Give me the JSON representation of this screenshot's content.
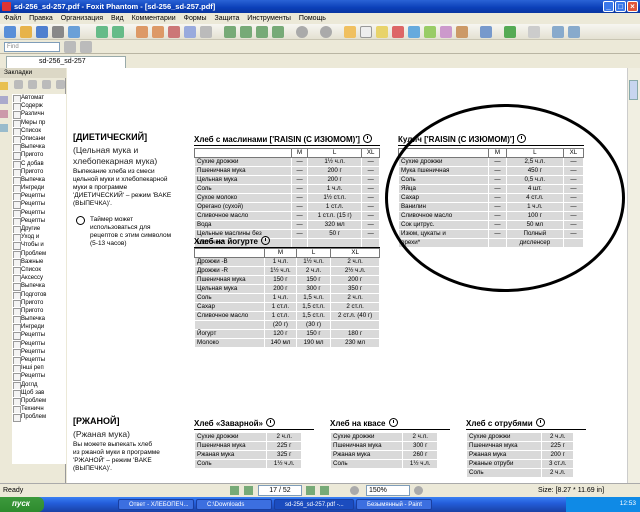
{
  "window": {
    "title": "sd-256_sd-257.pdf - Foxit Phantom - [sd-256_sd-257.pdf]"
  },
  "menu": [
    "Файл",
    "Правка",
    "Организация",
    "Вид",
    "Комментарии",
    "Формы",
    "Защита",
    "Инструменты",
    "Помощь"
  ],
  "find": {
    "placeholder": "Find"
  },
  "tab": {
    "label": "sd-256_sd-257"
  },
  "sidebar": {
    "title": "Закладки",
    "items": [
      "Автомат",
      "Содерж",
      "Различн",
      "Меры пр",
      "Список",
      "Описани",
      "Выпечка",
      "Пригото",
      "С добав",
      "Пригото",
      "Выпечка",
      "Ингреди",
      "Рецепты",
      "Рецепты",
      "Рецепты",
      "Рецепты",
      "Другие",
      "Уход и",
      "Чтобы и",
      "Проблем",
      "Важные",
      "Список",
      "Аксессу",
      "Выпечка",
      "Подготов",
      "Пригото",
      "Пригото",
      "Выпечка",
      "Ингреди",
      "Рецепты",
      "Рецепты",
      "Рецепты",
      "Рецепты",
      "Іншi реп",
      "Рецепты",
      "Доглд",
      "Щоб зав",
      "Проблем",
      "Техничн",
      "Проблем"
    ]
  },
  "doc": {
    "section1": {
      "heading": "[ДИЕТИЧЕСКИЙ]",
      "sub1": "(Цельная мука и",
      "sub2": "хлебопекарная мука)",
      "desc": [
        "Выпекание хлеба из смеси",
        "цельной муки и хлебопекарной",
        "муки в программе",
        "'ДИЕТИЧЕСКИЙ' – режим 'BAKE",
        "(ВЫПЕЧКА)'."
      ],
      "note": [
        "Таймер может",
        "использоваться для",
        "рецептов с этим символом",
        "(5-13 часов)"
      ]
    },
    "table_olive": {
      "title": "Хлеб с маслинами ['RAISIN (С ИЗЮМОМ)']",
      "cols": [
        "",
        "M",
        "L",
        "XL"
      ],
      "rows": [
        [
          "Сухие дрожжи",
          "—",
          "1½ ч.л.",
          "—"
        ],
        [
          "Пшеничная мука",
          "—",
          "200 г",
          "—"
        ],
        [
          "Цельная мука",
          "—",
          "200 г",
          "—"
        ],
        [
          "Соль",
          "—",
          "1 ч.л.",
          "—"
        ],
        [
          "Сухое молоко",
          "—",
          "1½ ст.л.",
          "—"
        ],
        [
          "Орегано (сухой)",
          "—",
          "1 ст.л.",
          "—"
        ],
        [
          "Сливочное масло",
          "—",
          "1 ст.л. (15 г)",
          "—"
        ],
        [
          "Вода",
          "—",
          "320 мл",
          "—"
        ],
        [
          "Цельные маслины без",
          "—",
          "50 г",
          "—"
        ],
        [
          "косточек*",
          "",
          "",
          ""
        ]
      ]
    },
    "table_yogurt": {
      "title": "Хлеб на йогурте",
      "cols": [
        "",
        "M",
        "L",
        "XL"
      ],
      "rows": [
        [
          "Дрожжи -B",
          "1 ч.л.",
          "1½ ч.л.",
          "2 ч.л."
        ],
        [
          "Дрожжи -R",
          "1½ ч.л.",
          "2 ч.л.",
          "2½ ч.л."
        ],
        [
          "Пшеничная мука",
          "150 г",
          "150 г",
          "200 г"
        ],
        [
          "Цельная мука",
          "200 г",
          "300 г",
          "350 г"
        ],
        [
          "Соль",
          "1 ч.л.",
          "1,5 ч.л.",
          "2 ч.л."
        ],
        [
          "Сахар",
          "1 ст.л.",
          "1,5 ст.л.",
          "2 ст.л."
        ],
        [
          "Сливочное масло",
          "1 ст.л.",
          "1,5 ст.л.",
          "2 ст.л. (40 г)"
        ],
        [
          "",
          "(20 г)",
          "(30 г)",
          ""
        ],
        [
          "Йогурт",
          "120 г",
          "150 г",
          "180 г"
        ],
        [
          "Молоко",
          "140 мл",
          "190 мл",
          "230 мл"
        ]
      ]
    },
    "table_kulich": {
      "title": "Кулич ['RAISIN (С ИЗЮМОМ)']",
      "cols": [
        "",
        "M",
        "L",
        "XL"
      ],
      "rows": [
        [
          "Сухие дрожжи",
          "—",
          "2,5 ч.л.",
          "—"
        ],
        [
          "Мука пшеничная",
          "—",
          "450 г",
          "—"
        ],
        [
          "Соль",
          "—",
          "0,5 ч.л.",
          "—"
        ],
        [
          "Яйца",
          "—",
          "4 шт.",
          "—"
        ],
        [
          "Сахар",
          "—",
          "4 ст.л.",
          "—"
        ],
        [
          "Ванилин",
          "—",
          "1 ч.л.",
          "—"
        ],
        [
          "Сливочное масло",
          "—",
          "100 г",
          "—"
        ],
        [
          "Сок цитрус.",
          "—",
          "50 мл",
          "—"
        ],
        [
          "Изюм, цукаты и",
          "—",
          "Полный",
          "—"
        ],
        [
          "орехи*",
          "",
          "дисленсер",
          ""
        ]
      ]
    },
    "section2": {
      "heading": "[РЖАНОЙ]",
      "sub1": "(Ржаная мука)",
      "desc": [
        "Вы можете выпекать хлеб",
        "из ржаной муки в программе",
        "'РЖАНОЙ' – режим 'BAKE",
        "(ВЫПЕЧКА)'."
      ]
    },
    "table_zavarnoy": {
      "title": "Хлеб «Заварной»",
      "rows": [
        [
          "Сухие дрожжи",
          "2 ч.л."
        ],
        [
          "Пшеничная мука",
          "225 г"
        ],
        [
          "Ржаная мука",
          "325 г"
        ],
        [
          "Соль",
          "1½ ч.л."
        ]
      ]
    },
    "table_kvas": {
      "title": "Хлеб на квасе",
      "rows": [
        [
          "Сухие дрожжи",
          "2 ч.л."
        ],
        [
          "Пшеничная мука",
          "300 г"
        ],
        [
          "Ржаная мука",
          "260 г"
        ],
        [
          "Соль",
          "1½ ч.л."
        ]
      ]
    },
    "table_otrubi": {
      "title": "Хлеб с отрубями",
      "rows": [
        [
          "Сухие дрожжи",
          "2 ч.л."
        ],
        [
          "Пшеничная мука",
          "225 г"
        ],
        [
          "Ржаная мука",
          "200 г"
        ],
        [
          "Ржаные отруби",
          "3 ст.л."
        ],
        [
          "Соль",
          "2 ч.л."
        ]
      ]
    }
  },
  "status": {
    "left": "Ready",
    "page": "17 / 52",
    "zoom": "150%",
    "size": "Size: [8.27 * 11.69 in]"
  },
  "taskbar": {
    "start": "пуск",
    "tasks": [
      "Ответ - ХЛЕБОПЕЧ...",
      "C:\\Downloads",
      "sd-256_sd-257.pdf -...",
      "Безымянный - Paint"
    ],
    "clock": "12:53"
  },
  "colors": {
    "titlebar": "#0b3fb8",
    "table_cell": "#d9d9d9",
    "taskbar": "#245edb",
    "start": "#2e8b2e"
  }
}
